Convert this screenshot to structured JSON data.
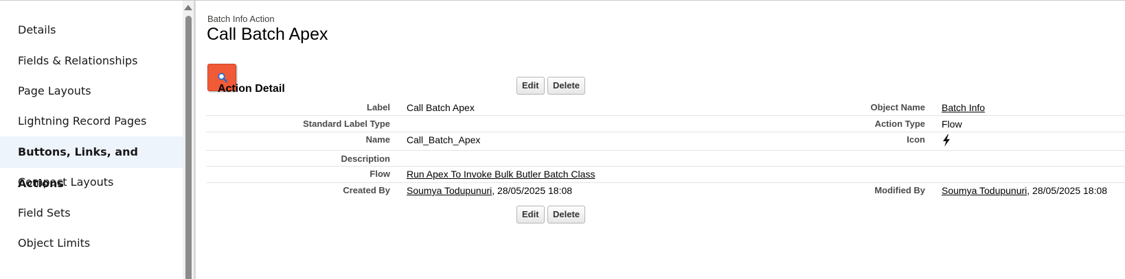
{
  "sidebar": {
    "items": [
      {
        "label": "Details"
      },
      {
        "label": "Fields & Relationships"
      },
      {
        "label": "Page Layouts"
      },
      {
        "label": "Lightning Record Pages"
      },
      {
        "label": "Buttons, Links, and Actions",
        "active": true
      },
      {
        "label": "Compact Layouts"
      },
      {
        "label": "Field Sets"
      },
      {
        "label": "Object Limits"
      }
    ]
  },
  "header": {
    "breadcrumb": "Batch Info Action",
    "title": "Call Batch Apex"
  },
  "icons": {
    "action_icon": "search-icon",
    "flow_icon": "lightning-bolt-icon"
  },
  "colors": {
    "action_icon_bg": "#f15a37",
    "active_sidebar_bg": "#eef4fb"
  },
  "detail": {
    "section_title": "Action Detail",
    "edit_label": "Edit",
    "delete_label": "Delete",
    "fields": {
      "label_label": "Label",
      "label_value": "Call Batch Apex",
      "object_name_label": "Object Name",
      "object_name_value": "Batch Info",
      "standard_label_type_label": "Standard Label Type",
      "standard_label_type_value": "",
      "action_type_label": "Action Type",
      "action_type_value": "Flow",
      "name_label": "Name",
      "name_value": "Call_Batch_Apex",
      "icon_label": "Icon",
      "description_label": "Description",
      "description_value": "",
      "flow_label": "Flow",
      "flow_value": "Run Apex To Invoke Bulk Butler Batch Class",
      "created_by_label": "Created By",
      "created_by_user": "Soumya Todupunuri",
      "created_by_date": ", 28/05/2025 18:08",
      "modified_by_label": "Modified By",
      "modified_by_user": "Soumya Todupunuri",
      "modified_by_date": ", 28/05/2025 18:08"
    }
  }
}
